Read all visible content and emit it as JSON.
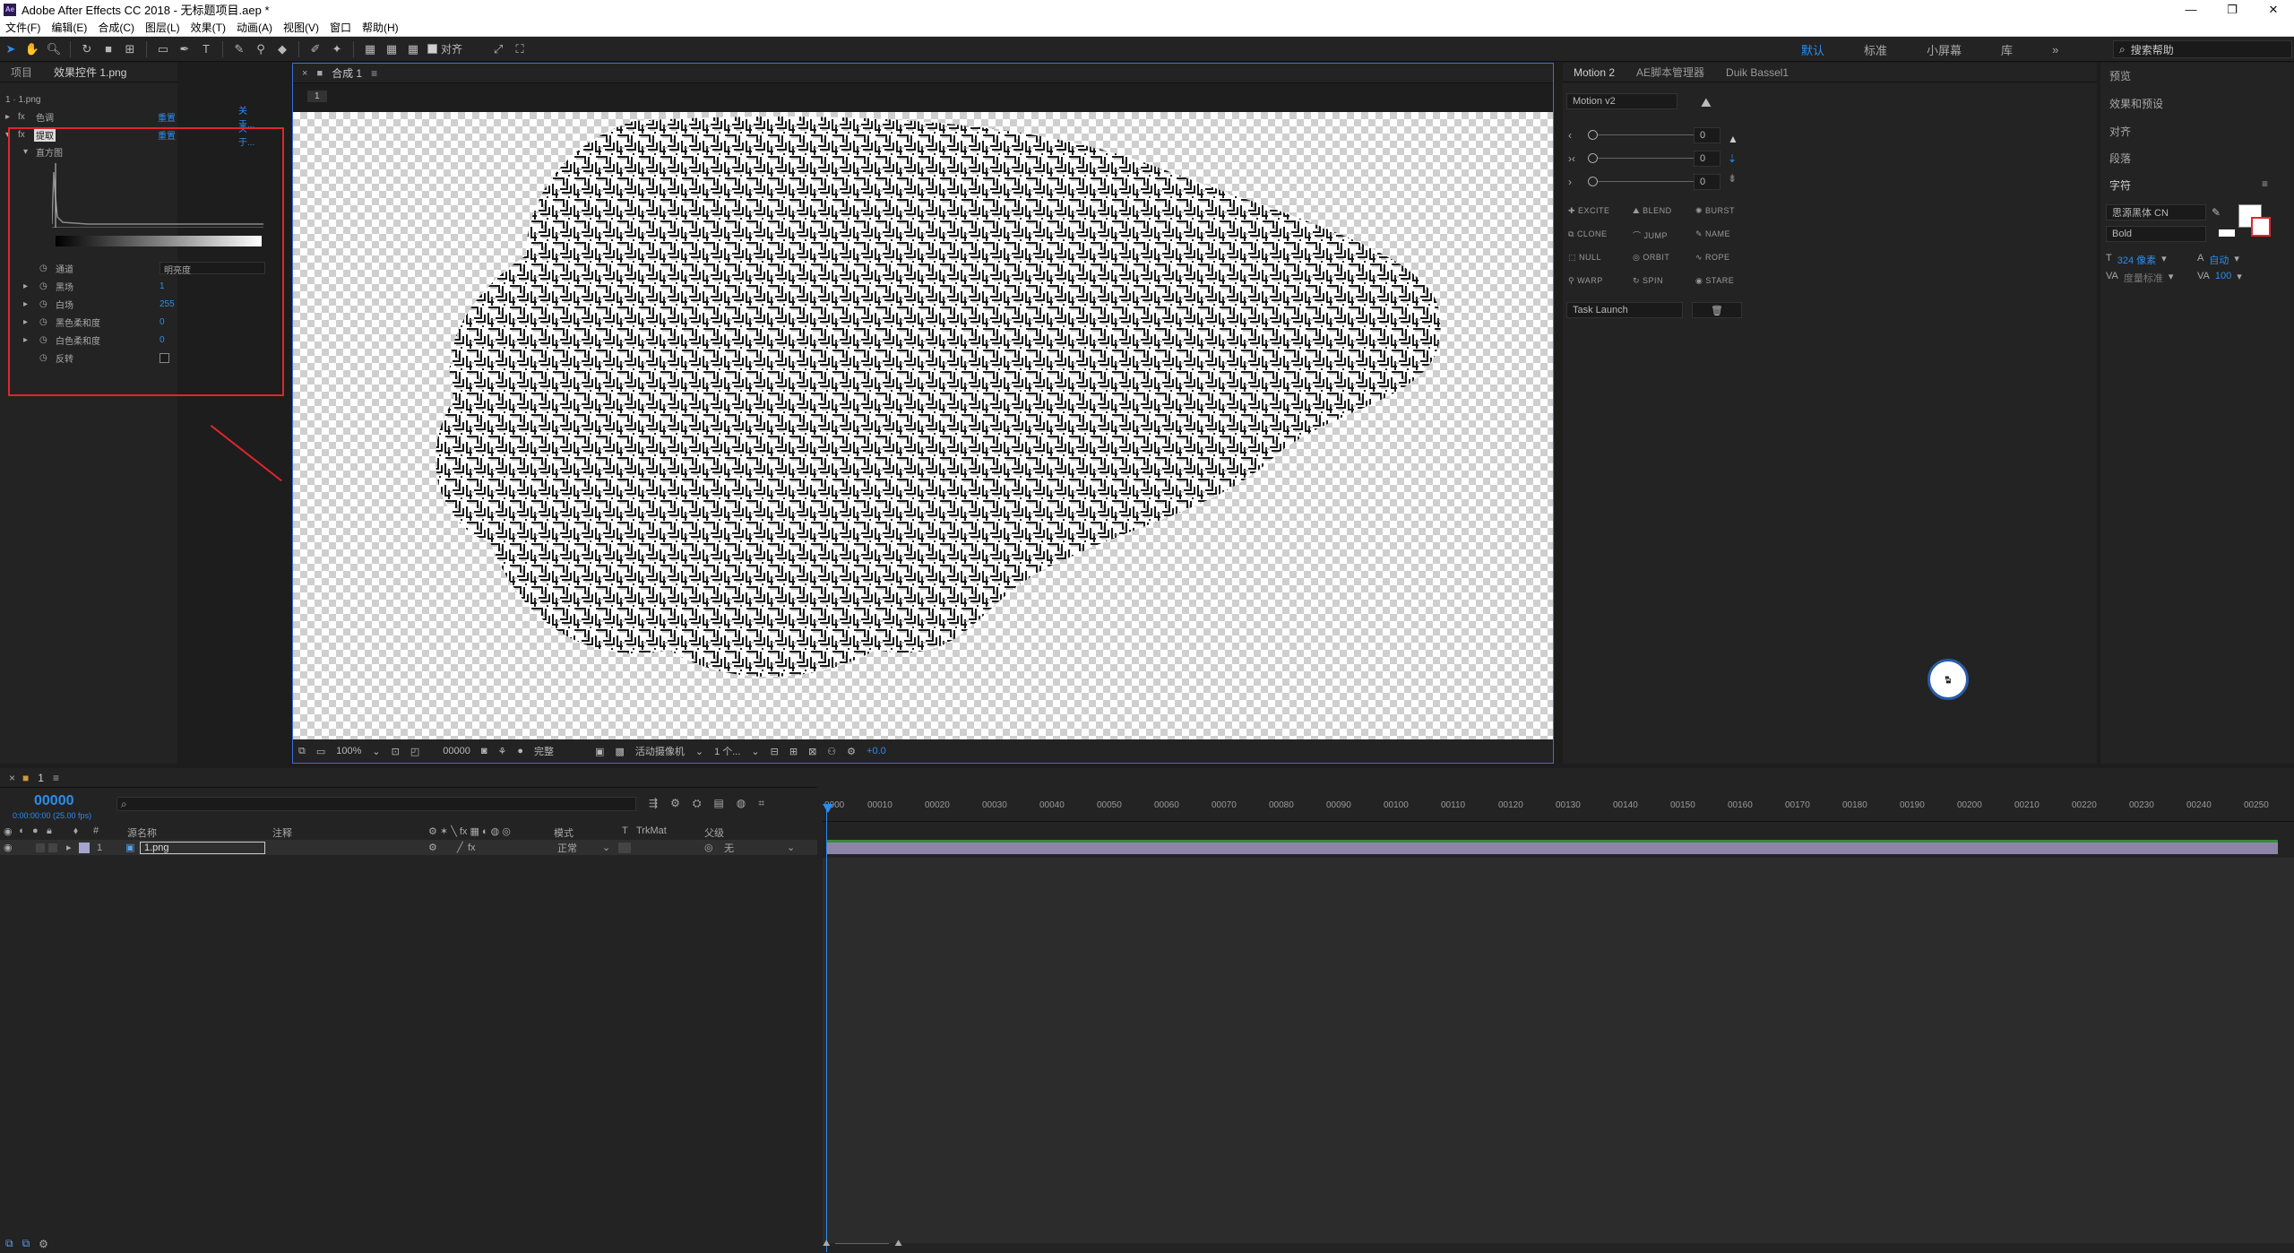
{
  "window": {
    "app_icon": "Ae",
    "title": "Adobe After Effects CC 2018 - 无标题项目.aep *",
    "minimize": "—",
    "restore": "❐",
    "close": "✕"
  },
  "menu": [
    "文件(F)",
    "编辑(E)",
    "合成(C)",
    "图层(L)",
    "效果(T)",
    "动画(A)",
    "视图(V)",
    "窗口",
    "帮助(H)"
  ],
  "toolbar": {
    "align_label": "对齐",
    "workspaces": [
      "默认",
      "标准",
      "小屏幕",
      "库"
    ],
    "search_placeholder": "搜索帮助"
  },
  "effect_panel": {
    "tabs": [
      "项目",
      "效果控件 1.png"
    ],
    "layer_path": "1 · 1.png",
    "effects": [
      {
        "name": "色调",
        "reset": "重置",
        "about": "关于..."
      },
      {
        "name": "提取",
        "reset": "重置",
        "about": "关于..."
      }
    ],
    "histogram_label": "直方图",
    "properties": [
      {
        "name": "通道",
        "value": "明亮度"
      },
      {
        "name": "黑场",
        "value": "1"
      },
      {
        "name": "白场",
        "value": "255"
      },
      {
        "name": "黑色柔和度",
        "value": "0"
      },
      {
        "name": "白色柔和度",
        "value": "0"
      },
      {
        "name": "反转",
        "value": ""
      }
    ]
  },
  "comp_panel": {
    "tab": "合成 1",
    "sub_tab": "1",
    "footer": {
      "zoom": "100%",
      "timecode": "00000",
      "resolution": "完整",
      "camera": "活动摄像机",
      "views": "1 个...",
      "exposure": "+0.0"
    }
  },
  "motion_panel": {
    "tabs": [
      "Motion 2",
      "AE脚本管理器",
      "Duik Bassel1"
    ],
    "version": "Motion v2",
    "slider_values": [
      "0",
      "0",
      "0"
    ],
    "buttons": [
      "EXCITE",
      "BLEND",
      "BURST",
      "CLONE",
      "JUMP",
      "NAME",
      "NULL",
      "ORBIT",
      "ROPE",
      "WARP",
      "SPIN",
      "STARE"
    ],
    "task_launch": "Task Launch"
  },
  "right_panel": {
    "items": [
      "预览",
      "效果和预设",
      "对齐",
      "段落"
    ],
    "char_title": "字符",
    "font": "思源黑体 CN",
    "weight": "Bold",
    "size": "324 像素",
    "leading": "自动",
    "kerning": "度量标准",
    "tracking": "100"
  },
  "timeline": {
    "tab": "1",
    "timecode": "00000",
    "timecode_sub": "0:00:00:00 (25.00 fps)",
    "columns": {
      "name": "源名称",
      "comment": "注释",
      "mode": "模式",
      "t": "T",
      "trkmat": "TrkMat",
      "parent": "父级"
    },
    "layer": {
      "index": "1",
      "name": "1.png",
      "mode": "正常",
      "parent": "无"
    },
    "ticks": [
      "0000",
      "00010",
      "00020",
      "00030",
      "00040",
      "00050",
      "00060",
      "00070",
      "00080",
      "00090",
      "00100",
      "00110",
      "00120",
      "00130",
      "00140",
      "00150",
      "00160",
      "00170",
      "00180",
      "00190",
      "00200",
      "00210",
      "00220",
      "00230",
      "00240",
      "00250"
    ]
  },
  "colors": {
    "accent": "#2d8ceb",
    "highlight": "#e1252c",
    "layer_bar": "#8c85a8"
  }
}
